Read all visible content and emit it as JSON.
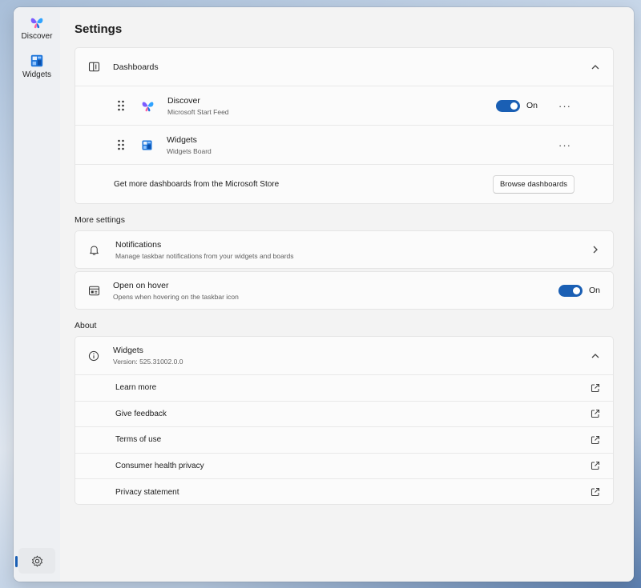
{
  "rail": {
    "items": [
      {
        "label": "Discover",
        "icon": "butterfly-icon"
      },
      {
        "label": "Widgets",
        "icon": "widgets-icon"
      }
    ],
    "settings_icon": "gear-icon"
  },
  "header": {
    "title": "Settings"
  },
  "dashboards": {
    "title": "Dashboards",
    "items": [
      {
        "title": "Discover",
        "subtitle": "Microsoft Start Feed",
        "toggle_label": "On"
      },
      {
        "title": "Widgets",
        "subtitle": "Widgets Board"
      }
    ],
    "store_text": "Get more dashboards from the Microsoft Store",
    "browse_button": "Browse dashboards"
  },
  "more_settings": {
    "label": "More settings",
    "notifications": {
      "title": "Notifications",
      "subtitle": "Manage taskbar notifications from your widgets and boards"
    },
    "open_on_hover": {
      "title": "Open on hover",
      "subtitle": "Opens when hovering on the taskbar icon",
      "toggle_label": "On"
    }
  },
  "about": {
    "label": "About",
    "app": {
      "title": "Widgets",
      "version": "Version: 525.31002.0.0"
    },
    "links": [
      "Learn more",
      "Give feedback",
      "Terms of use",
      "Consumer health privacy",
      "Privacy statement"
    ]
  },
  "colors": {
    "accent": "#1a5fb4",
    "background": "#f3f3f3"
  }
}
